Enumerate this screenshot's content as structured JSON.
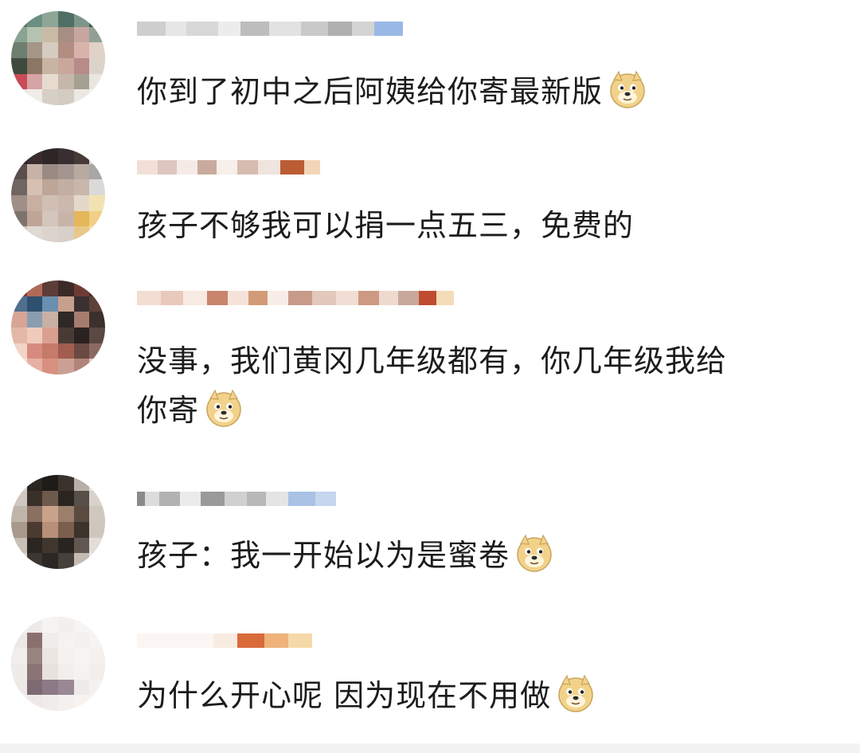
{
  "comments": [
    {
      "text": "你到了初中之后阿姨给你寄最新版",
      "emoji": "doge-icon"
    },
    {
      "text": "孩子不够我可以捐一点五三，免费的",
      "emoji": ""
    },
    {
      "text": "没事，我们黄冈几年级都有，你几年级我给\n你寄",
      "emoji": "doge-icon"
    },
    {
      "text": "孩子：我一开始以为是蜜卷",
      "emoji": "doge-icon"
    },
    {
      "text": "为什么开心呢 因为现在不用做",
      "emoji": "doge-icon"
    }
  ],
  "colors": {
    "text": "#1c1c1c",
    "background": "#ffffff",
    "doge_face": "#f2d28a"
  }
}
